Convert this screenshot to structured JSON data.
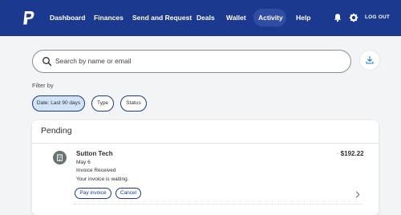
{
  "nav": {
    "items": [
      "Dashboard",
      "Finances",
      "Send and Request",
      "Deals",
      "Wallet",
      "Activity",
      "Help"
    ],
    "active": "Activity",
    "logout_label": "LOG OUT",
    "icons": [
      "paypal-logo",
      "bell-icon",
      "gear-icon"
    ]
  },
  "search": {
    "placeholder": "Search by name or email",
    "download_icon": "download-icon"
  },
  "filters": {
    "label": "Filter by",
    "chips": [
      "Date: Last 90 days",
      "Type",
      "Status"
    ],
    "active_chip": "Date: Last 90 days"
  },
  "pending": {
    "title": "Pending",
    "transaction": {
      "name": "Sutton Tech",
      "date": "May 6",
      "type": "Invoice Received",
      "note": "Your invoice is waiting.",
      "amount_prefix": "-",
      "amount": "$192.22",
      "pay_label": "Pay invoice",
      "cancel_label": "Cancel"
    }
  },
  "colors": {
    "nav_bg": "#1b3a8f",
    "accent": "#1b3a8f",
    "chip_active_bg": "#d1e4f7",
    "pending_dash": "#e3a000"
  }
}
